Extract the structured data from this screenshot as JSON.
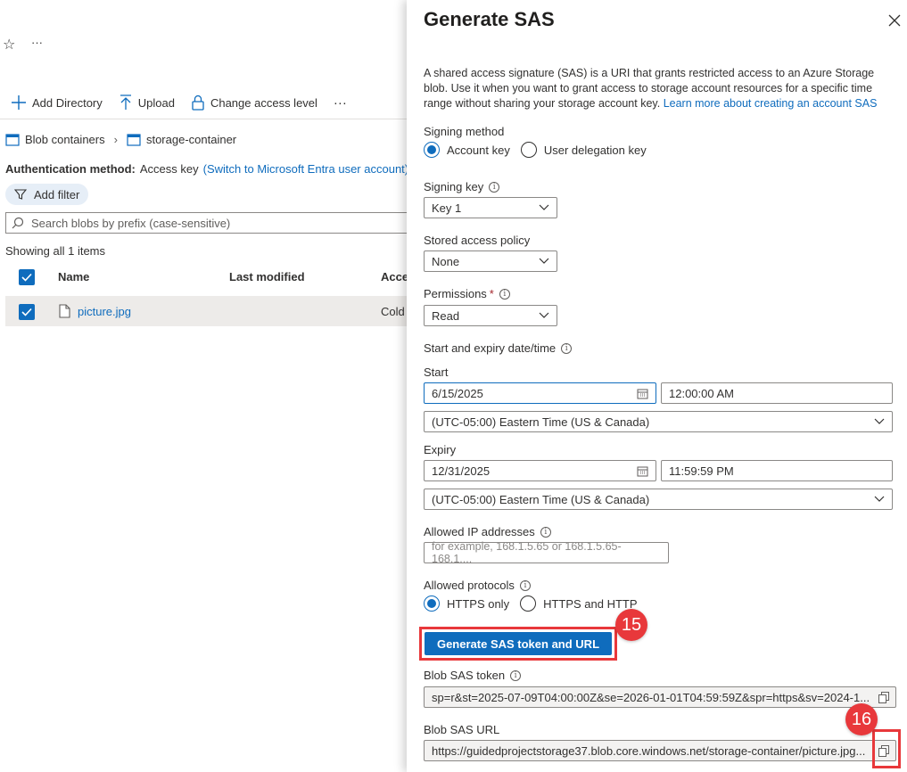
{
  "toolbar": {
    "add_directory": "Add Directory",
    "upload": "Upload",
    "change_access": "Change access level",
    "more": "···",
    "top_more": "···"
  },
  "breadcrumb": {
    "root": "Blob containers",
    "current": "storage-container"
  },
  "auth": {
    "label": "Authentication method:",
    "value": "Access key",
    "link": "(Switch to Microsoft Entra user account)"
  },
  "filter": {
    "label": "Add filter"
  },
  "search": {
    "placeholder": "Search blobs by prefix (case-sensitive)"
  },
  "list": {
    "count_text": "Showing all 1 items",
    "columns": [
      "Name",
      "Last modified",
      "Acce"
    ],
    "rows": [
      {
        "name": "picture.jpg",
        "access_tier": "Cold"
      }
    ]
  },
  "panel": {
    "title": "Generate SAS",
    "description": "A shared access signature (SAS) is a URI that grants restricted access to an Azure Storage blob. Use it when you want to grant access to storage account resources for a specific time range without sharing your storage account key.",
    "description_link": "Learn more about creating an account SAS",
    "signing_method": {
      "label": "Signing method",
      "options": [
        "Account key",
        "User delegation key"
      ],
      "selected": "Account key"
    },
    "signing_key": {
      "label": "Signing key",
      "value": "Key 1"
    },
    "stored_policy": {
      "label": "Stored access policy",
      "value": "None"
    },
    "permissions": {
      "label": "Permissions",
      "required_mark": "*",
      "value": "Read"
    },
    "datetime": {
      "label": "Start and expiry date/time",
      "start_label": "Start",
      "start_date": "6/15/2025",
      "start_time": "12:00:00 AM",
      "start_tz": "(UTC-05:00) Eastern Time (US & Canada)",
      "expiry_label": "Expiry",
      "expiry_date": "12/31/2025",
      "expiry_time": "11:59:59 PM",
      "expiry_tz": "(UTC-05:00) Eastern Time (US & Canada)"
    },
    "allowed_ip": {
      "label": "Allowed IP addresses",
      "placeholder": "for example, 168.1.5.65 or 168.1.5.65-168.1...."
    },
    "protocols": {
      "label": "Allowed protocols",
      "options": [
        "HTTPS only",
        "HTTPS and HTTP"
      ],
      "selected": "HTTPS only"
    },
    "generate_button": "Generate SAS token and URL",
    "token": {
      "label": "Blob SAS token",
      "value": "sp=r&st=2025-07-09T04:00:00Z&se=2026-01-01T04:59:59Z&spr=https&sv=2024-1..."
    },
    "url": {
      "label": "Blob SAS URL",
      "value": "https://guidedprojectstorage37.blob.core.windows.net/storage-container/picture.jpg..."
    }
  },
  "annotations": {
    "step15": "15",
    "step16": "16"
  },
  "colors": {
    "accent": "#0f6cbd",
    "annotation": "#e8383b"
  }
}
